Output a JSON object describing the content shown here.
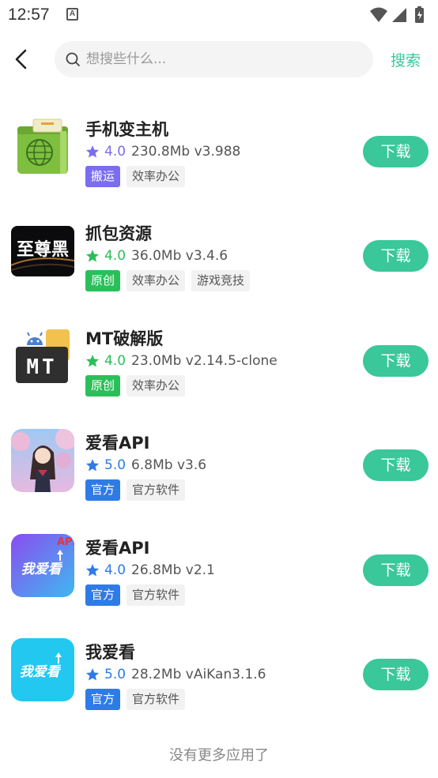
{
  "status_bar": {
    "time": "12:57",
    "notification_letter": "A"
  },
  "header": {
    "search_placeholder": "想搜些什么...",
    "search_button": "搜索"
  },
  "apps": [
    {
      "name": "手机变主机",
      "rating": "4.0",
      "size": "230.8Mb",
      "version": "v3.988",
      "star_color": "#7b6cf0",
      "tags": [
        {
          "label": "搬运",
          "bg": "#7b6cf0",
          "fg": "#ffffff"
        },
        {
          "label": "效率办公"
        }
      ],
      "download_label": "下载",
      "icon": "folder-globe-icon"
    },
    {
      "name": "抓包资源",
      "rating": "4.0",
      "size": "36.0Mb",
      "version": "v3.4.6",
      "star_color": "#2bbf5a",
      "tags": [
        {
          "label": "原创",
          "bg": "#2bbf5a",
          "fg": "#ffffff"
        },
        {
          "label": "效率办公"
        },
        {
          "label": "游戏竞技"
        }
      ],
      "download_label": "下载",
      "icon": "dark-banner-icon",
      "icon_text": "至尊黑"
    },
    {
      "name": "MT破解版",
      "rating": "4.0",
      "size": "23.0Mb",
      "version": "v2.14.5-clone",
      "star_color": "#2bbf5a",
      "tags": [
        {
          "label": "原创",
          "bg": "#2bbf5a",
          "fg": "#ffffff"
        },
        {
          "label": "效率办公"
        }
      ],
      "download_label": "下载",
      "icon": "mt-manager-icon",
      "icon_text": "MT"
    },
    {
      "name": "爱看API",
      "rating": "5.0",
      "size": "6.8Mb",
      "version": "v3.6",
      "star_color": "#2f7be5",
      "tags": [
        {
          "label": "官方",
          "bg": "#2f7be5",
          "fg": "#ffffff"
        },
        {
          "label": "官方软件"
        }
      ],
      "download_label": "下载",
      "icon": "anime-girl-icon"
    },
    {
      "name": "爱看API",
      "rating": "4.0",
      "size": "26.8Mb",
      "version": "v2.1",
      "star_color": "#2f7be5",
      "tags": [
        {
          "label": "官方",
          "bg": "#2f7be5",
          "fg": "#ffffff"
        },
        {
          "label": "官方软件"
        }
      ],
      "download_label": "下载",
      "icon": "woaikan-purple-icon",
      "icon_text": "我爱看",
      "icon_badge": "API"
    },
    {
      "name": "我爱看",
      "rating": "5.0",
      "size": "28.2Mb",
      "version": "vAiKan3.1.6",
      "star_color": "#2f7be5",
      "tags": [
        {
          "label": "官方",
          "bg": "#2f7be5",
          "fg": "#ffffff"
        },
        {
          "label": "官方软件"
        }
      ],
      "download_label": "下载",
      "icon": "woaikan-cyan-icon",
      "icon_text": "我爱看"
    }
  ],
  "footer": {
    "text": "没有更多应用了"
  },
  "colors": {
    "accent": "#3ac79a"
  }
}
